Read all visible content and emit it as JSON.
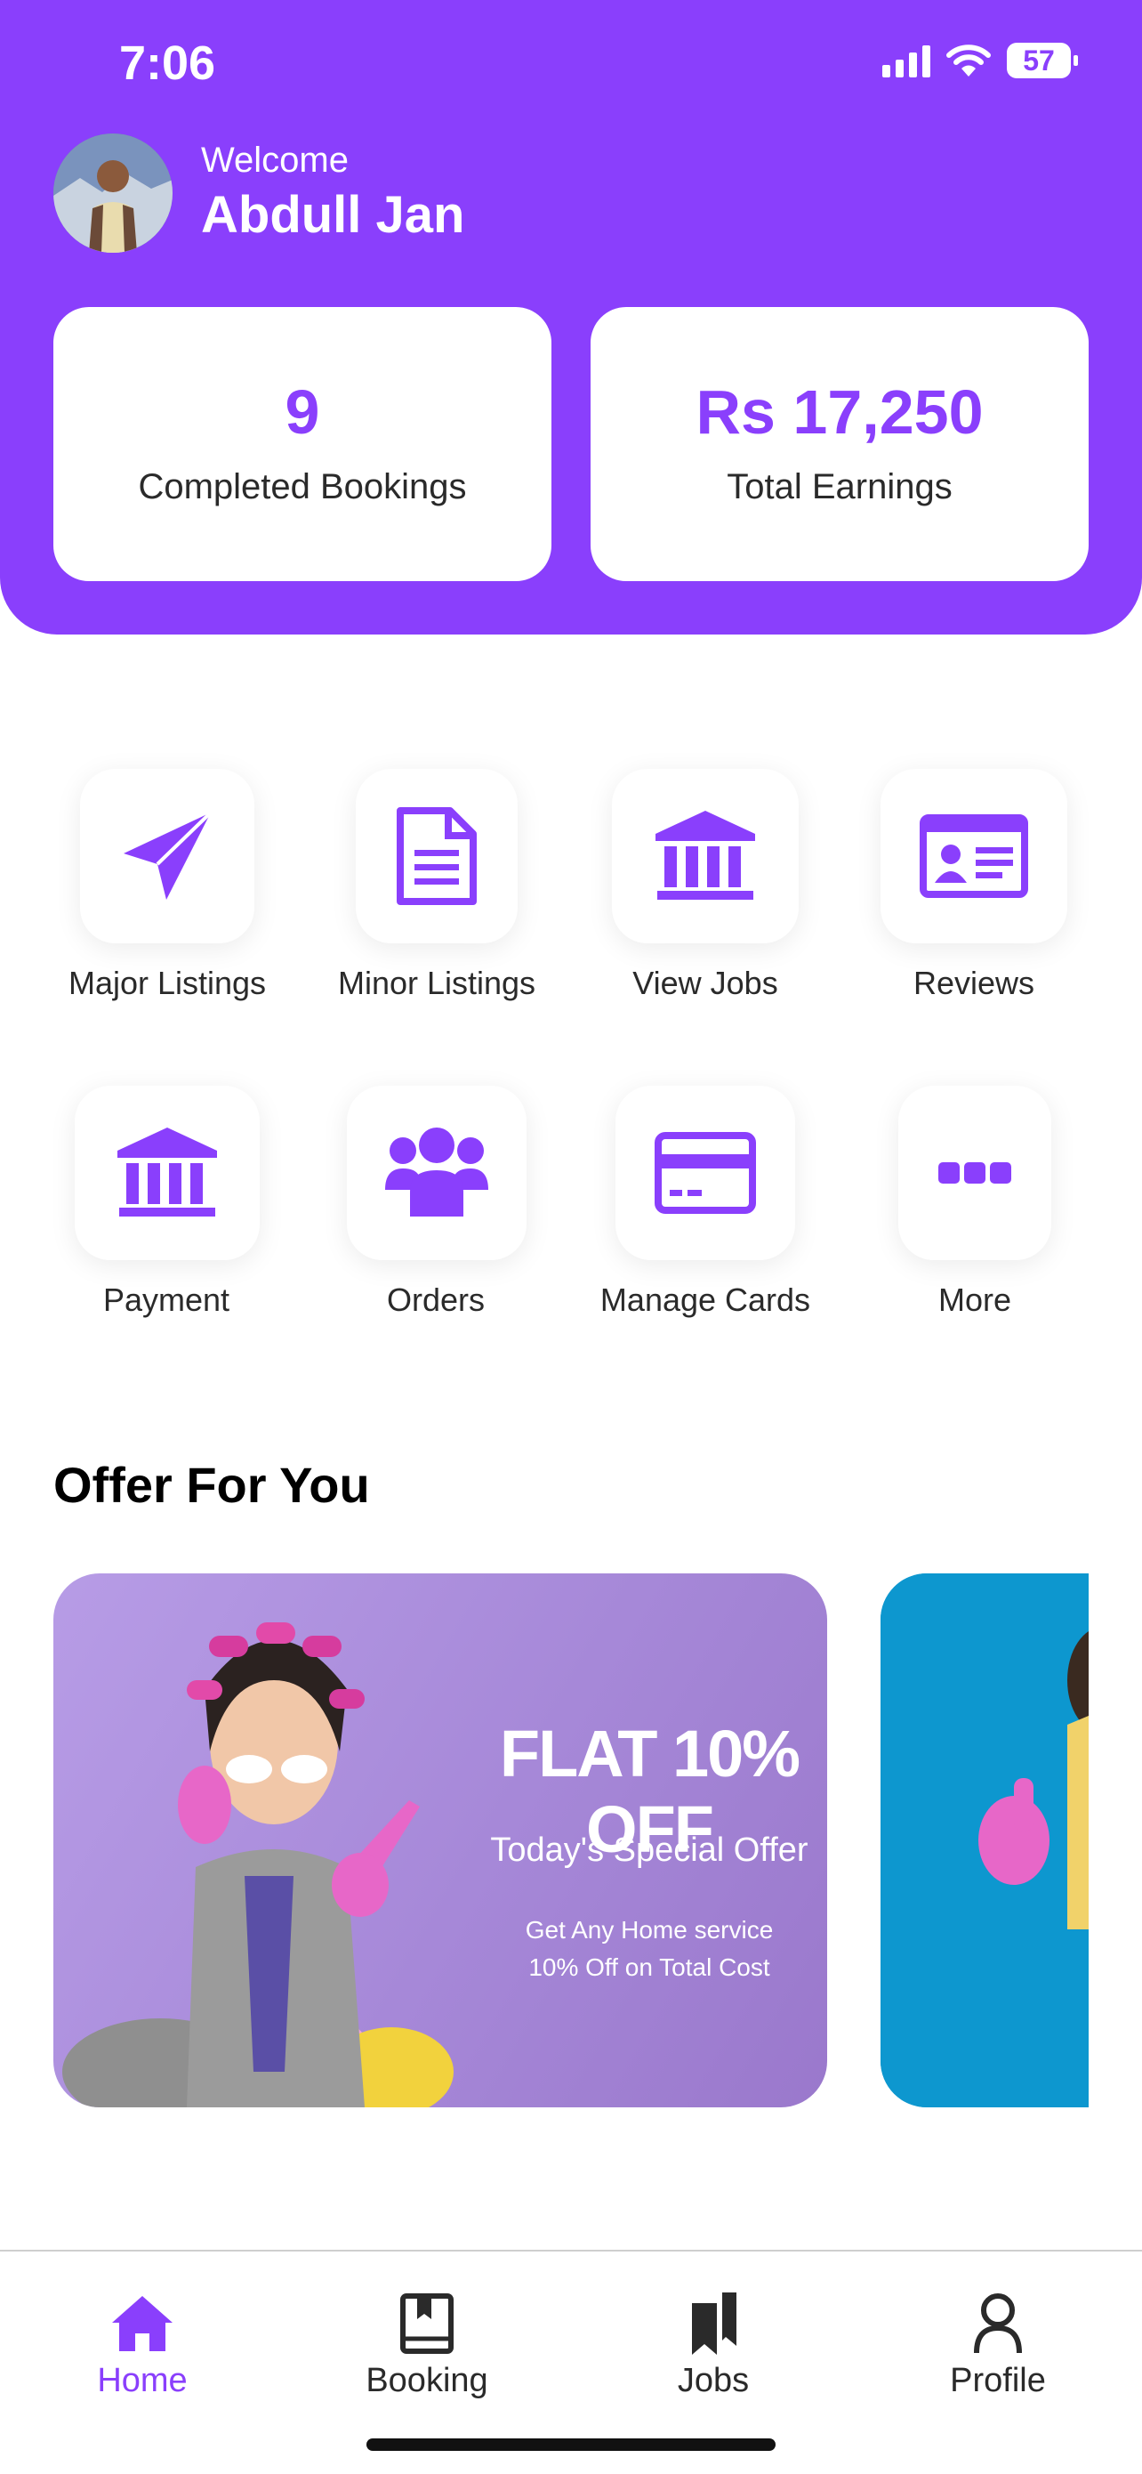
{
  "status": {
    "time": "7:06",
    "battery": "57"
  },
  "header": {
    "welcome": "Welcome",
    "name": "Abdull Jan"
  },
  "stats": [
    {
      "value": "9",
      "label": "Completed Bookings"
    },
    {
      "value": "Rs 17,250",
      "label": "Total Earnings"
    }
  ],
  "actions": [
    {
      "label": "Major Listings",
      "icon": "paper-plane-icon"
    },
    {
      "label": "Minor Listings",
      "icon": "document-icon"
    },
    {
      "label": "View Jobs",
      "icon": "bank-icon"
    },
    {
      "label": "Reviews",
      "icon": "id-card-icon"
    },
    {
      "label": "Payment",
      "icon": "bank-icon"
    },
    {
      "label": "Orders",
      "icon": "users-icon"
    },
    {
      "label": "Manage Cards",
      "icon": "credit-card-icon"
    },
    {
      "label": "More",
      "icon": "more-dots-icon"
    }
  ],
  "offers": {
    "title": "Offer For You",
    "card1": {
      "headline": "FLAT 10% OFF",
      "subheadline": "Today's Special Offer",
      "description": "Get Any Home service 10% Off on Total Cost"
    }
  },
  "tabs": [
    {
      "label": "Home",
      "icon": "home-icon",
      "active": true
    },
    {
      "label": "Booking",
      "icon": "book-icon",
      "active": false
    },
    {
      "label": "Jobs",
      "icon": "bookmarks-icon",
      "active": false
    },
    {
      "label": "Profile",
      "icon": "user-icon",
      "active": false
    }
  ],
  "colors": {
    "primary": "#8A3FFC",
    "text": "#2a2a2a",
    "background": "#ffffff"
  }
}
